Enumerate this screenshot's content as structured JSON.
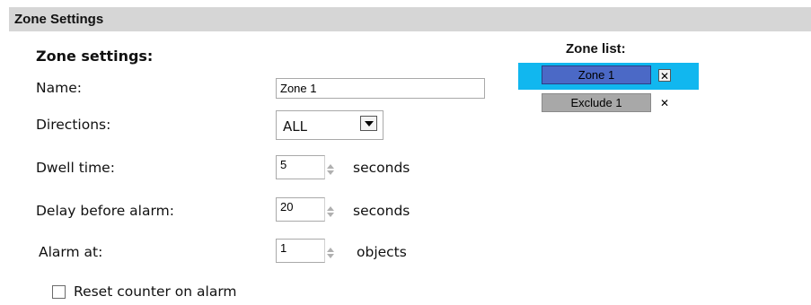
{
  "panel": {
    "title": "Zone Settings"
  },
  "form": {
    "section_title": "Zone settings:",
    "name": {
      "label": "Name:",
      "value": "Zone 1"
    },
    "directions": {
      "label": "Directions:",
      "value": "ALL"
    },
    "dwell_time": {
      "label": "Dwell time:",
      "value": "5",
      "unit": "seconds"
    },
    "delay_before_alarm": {
      "label": "Delay before alarm:",
      "value": "20",
      "unit": "seconds"
    },
    "alarm_at": {
      "label": "Alarm at:",
      "value": "1",
      "unit": "objects"
    },
    "reset_counter": {
      "label": "Reset counter on alarm",
      "checked": false
    }
  },
  "zone_list": {
    "title": "Zone list:",
    "items": [
      {
        "label": "Zone 1",
        "selected": true,
        "color": "#4b69c6",
        "remove_icon": "close-icon"
      },
      {
        "label": "Exclude 1",
        "selected": false,
        "color": "#a8a8a8",
        "remove_icon": "close-icon"
      }
    ],
    "selected_row_color": "#11b7ef"
  },
  "icons": {
    "dropdown": "dropdown-arrow-icon",
    "spinner": "spinner-icon",
    "remove": "close-icon"
  }
}
